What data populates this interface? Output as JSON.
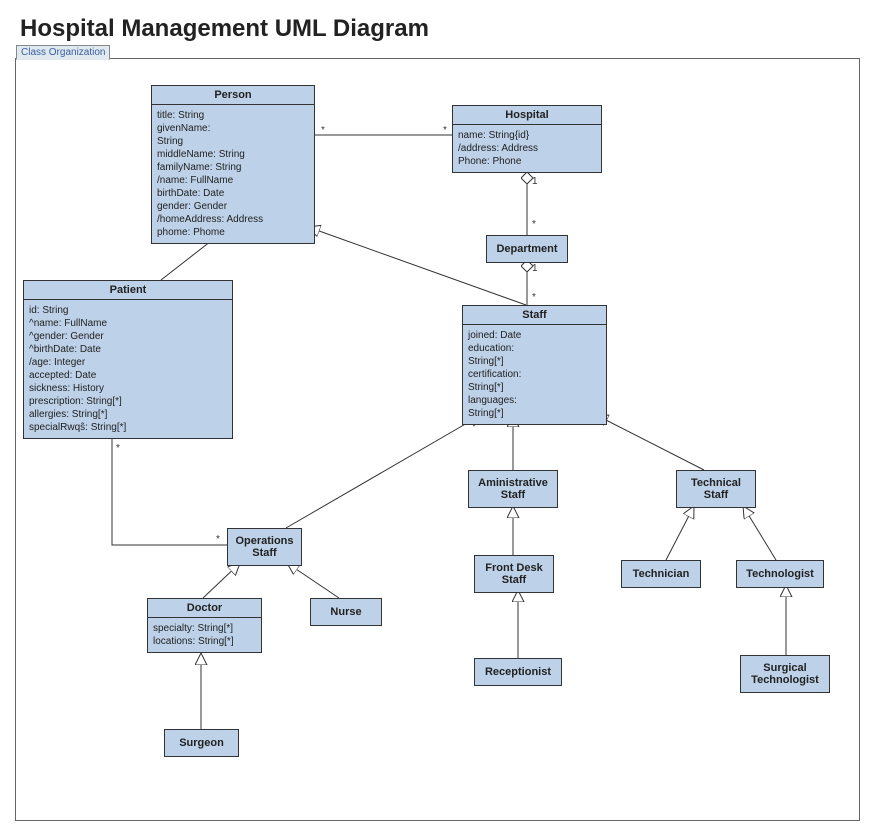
{
  "title": "Hospital Management UML Diagram",
  "tab_label": "Class Organization",
  "classes": {
    "person": {
      "name": "Person",
      "attrs": [
        "title: String",
        "givenName:",
        "String",
        "middleName: String",
        "familyName: String",
        "/name: FullName",
        "birthDate: Date",
        "gender: Gender",
        "/homeAddress: Address",
        "phome: Phome"
      ]
    },
    "hospital": {
      "name": "Hospital",
      "attrs": [
        "name: String{id}",
        "/address: Address",
        "Phone: Phone"
      ]
    },
    "department": {
      "name": "Department"
    },
    "patient": {
      "name": "Patient",
      "attrs": [
        "id: String",
        "^name: FullName",
        "^gender: Gender",
        "^birthDate: Date",
        "/age: Integer",
        "accepted: Date",
        "sickness: History",
        "prescription: String[*]",
        "allergies: String[*]",
        "specialRwqŝ: String[*]"
      ]
    },
    "staff": {
      "name": "Staff",
      "attrs": [
        "joined: Date",
        "education:",
        "String[*]",
        "certification:",
        "String[*]",
        "languages:",
        "String[*]"
      ]
    },
    "administrative_staff": {
      "name": "Aministrative\nStaff"
    },
    "technical_staff": {
      "name": "Technical\nStaff"
    },
    "operations_staff": {
      "name": "Operations\nStaff"
    },
    "front_desk_staff": {
      "name": "Front Desk\nStaff"
    },
    "doctor": {
      "name": "Doctor",
      "attrs": [
        "specialty: String[*]",
        "locations: String[*]"
      ]
    },
    "nurse": {
      "name": "Nurse"
    },
    "technician": {
      "name": "Technician"
    },
    "technologist": {
      "name": "Technologist"
    },
    "receptionist": {
      "name": "Receptionist"
    },
    "surgeon": {
      "name": "Surgeon"
    },
    "surgical_technologist": {
      "name": "Surgical\nTechnologist"
    }
  },
  "multiplicities": {
    "person_hospital_left": "*",
    "person_hospital_right": "*",
    "hospital_department_top": "1",
    "hospital_department_bottom": "*",
    "department_staff_top": "1",
    "department_staff_bottom": "*",
    "patient_ops_top": "*",
    "patient_ops_bottom": "*"
  },
  "relations_desc": [
    "Person -- Hospital : association * to *",
    "Hospital <>-- Department : aggregation 1 to *",
    "Department <>-- Staff : aggregation 1 to *",
    "Patient --|> Person : generalization",
    "Staff --|> Person : generalization",
    "Operations Staff --|> Staff : generalization",
    "Aministrative Staff --|> Staff : generalization",
    "Technical Staff --|> Staff : generalization",
    "Doctor --|> Operations Staff : generalization",
    "Nurse --|> Operations Staff : generalization",
    "Front Desk Staff --|> Aministrative Staff : generalization",
    "Receptionist --|> Front Desk Staff : generalization",
    "Technician --|> Technical Staff : generalization",
    "Technologist --|> Technical Staff : generalization",
    "Surgical Technologist --|> Technologist : generalization",
    "Surgeon --|> Doctor : generalization",
    "Patient -- Operations Staff : association * to *"
  ]
}
